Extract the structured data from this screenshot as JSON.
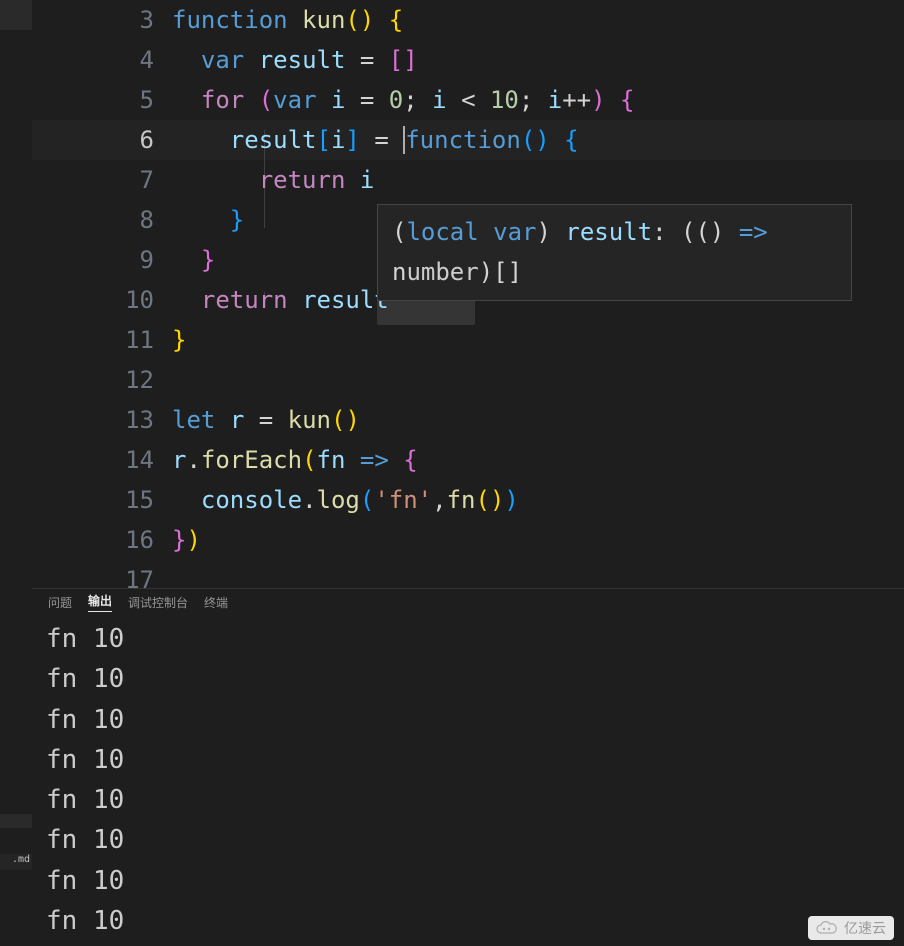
{
  "sidebar": {
    "file_ext_label": ".md"
  },
  "editor": {
    "lines": [
      {
        "num": "3",
        "tokens": [
          [
            "tk-keyword",
            "function"
          ],
          [
            "tk-punc",
            " "
          ],
          [
            "tk-fnname",
            "kun"
          ],
          [
            "tk-bracket-y",
            "("
          ],
          [
            "tk-bracket-y",
            ")"
          ],
          [
            "tk-punc",
            " "
          ],
          [
            "tk-bracket-y",
            "{"
          ]
        ]
      },
      {
        "num": "4",
        "indent": 1,
        "tokens": [
          [
            "tk-keyword",
            "var"
          ],
          [
            "tk-punc",
            " "
          ],
          [
            "tk-var",
            "result"
          ],
          [
            "tk-punc",
            " "
          ],
          [
            "tk-op",
            "="
          ],
          [
            "tk-punc",
            " "
          ],
          [
            "tk-bracket-p",
            "["
          ],
          [
            "tk-bracket-p",
            "]"
          ]
        ]
      },
      {
        "num": "5",
        "indent": 1,
        "tokens": [
          [
            "tk-keyword-ctrl",
            "for"
          ],
          [
            "tk-punc",
            " "
          ],
          [
            "tk-bracket-p",
            "("
          ],
          [
            "tk-keyword",
            "var"
          ],
          [
            "tk-punc",
            " "
          ],
          [
            "tk-var",
            "i"
          ],
          [
            "tk-punc",
            " "
          ],
          [
            "tk-op",
            "="
          ],
          [
            "tk-punc",
            " "
          ],
          [
            "tk-num",
            "0"
          ],
          [
            "tk-punc",
            ";"
          ],
          [
            "tk-punc",
            " "
          ],
          [
            "tk-var",
            "i"
          ],
          [
            "tk-punc",
            " "
          ],
          [
            "tk-op",
            "<"
          ],
          [
            "tk-punc",
            " "
          ],
          [
            "tk-num",
            "10"
          ],
          [
            "tk-punc",
            ";"
          ],
          [
            "tk-punc",
            " "
          ],
          [
            "tk-var",
            "i"
          ],
          [
            "tk-op",
            "++"
          ],
          [
            "tk-bracket-p",
            ")"
          ],
          [
            "tk-punc",
            " "
          ],
          [
            "tk-bracket-p",
            "{"
          ]
        ]
      },
      {
        "num": "6",
        "indent": 2,
        "active": true,
        "cursor_at": 3,
        "tokens": [
          [
            "tk-var",
            "result"
          ],
          [
            "tk-bracket-b",
            "["
          ],
          [
            "tk-var",
            "i"
          ],
          [
            "tk-bracket-b",
            "]"
          ],
          [
            "tk-punc",
            " "
          ],
          [
            "tk-op",
            "="
          ],
          [
            "tk-punc",
            " "
          ],
          [
            "tk-keyword",
            "function"
          ],
          [
            "tk-bracket-b",
            "("
          ],
          [
            "tk-bracket-b",
            ")"
          ],
          [
            "tk-punc",
            " "
          ],
          [
            "tk-bracket-b",
            "{"
          ]
        ]
      },
      {
        "num": "7",
        "indent": 3,
        "tokens": [
          [
            "tk-keyword-ctrl",
            "return"
          ],
          [
            "tk-punc",
            " "
          ],
          [
            "tk-var",
            "i"
          ]
        ]
      },
      {
        "num": "8",
        "indent": 2,
        "tokens": [
          [
            "tk-bracket-b",
            "}"
          ]
        ]
      },
      {
        "num": "9",
        "indent": 1,
        "tokens": [
          [
            "tk-bracket-p",
            "}"
          ]
        ]
      },
      {
        "num": "10",
        "indent": 1,
        "tokens": [
          [
            "tk-keyword-ctrl",
            "return"
          ],
          [
            "tk-punc",
            " "
          ],
          [
            "tk-var",
            "result"
          ]
        ]
      },
      {
        "num": "11",
        "tokens": [
          [
            "tk-bracket-y",
            "}"
          ]
        ]
      },
      {
        "num": "12",
        "tokens": []
      },
      {
        "num": "13",
        "tokens": [
          [
            "tk-keyword",
            "let"
          ],
          [
            "tk-punc",
            " "
          ],
          [
            "tk-var",
            "r"
          ],
          [
            "tk-punc",
            " "
          ],
          [
            "tk-op",
            "="
          ],
          [
            "tk-punc",
            " "
          ],
          [
            "tk-fnname",
            "kun"
          ],
          [
            "tk-bracket-y",
            "("
          ],
          [
            "tk-bracket-y",
            ")"
          ]
        ]
      },
      {
        "num": "14",
        "tokens": [
          [
            "tk-var",
            "r"
          ],
          [
            "tk-punc",
            "."
          ],
          [
            "tk-prop",
            "forEach"
          ],
          [
            "tk-bracket-y",
            "("
          ],
          [
            "tk-var",
            "fn"
          ],
          [
            "tk-punc",
            " "
          ],
          [
            "tk-keyword",
            "=>"
          ],
          [
            "tk-punc",
            " "
          ],
          [
            "tk-bracket-p",
            "{"
          ]
        ]
      },
      {
        "num": "15",
        "indent": 1,
        "tokens": [
          [
            "tk-var",
            "console"
          ],
          [
            "tk-punc",
            "."
          ],
          [
            "tk-prop",
            "log"
          ],
          [
            "tk-bracket-b",
            "("
          ],
          [
            "tk-str",
            "'fn'"
          ],
          [
            "tk-punc",
            ","
          ],
          [
            "tk-fnname",
            "fn"
          ],
          [
            "tk-bracket-y",
            "("
          ],
          [
            "tk-bracket-y",
            ")"
          ],
          [
            "tk-bracket-b",
            ")"
          ]
        ]
      },
      {
        "num": "16",
        "tokens": [
          [
            "tk-bracket-p",
            "}"
          ],
          [
            "tk-bracket-y",
            ")"
          ]
        ]
      },
      {
        "num": "17",
        "tokens": []
      }
    ],
    "indent_width": 2,
    "hover": {
      "text_parts": [
        [
          "tt-punc",
          "("
        ],
        [
          "tt-kw",
          "local var"
        ],
        [
          "tt-punc",
          ") "
        ],
        [
          "tt-var",
          "result"
        ],
        [
          "tt-punc",
          ": (() "
        ],
        [
          "tt-kw",
          "=>"
        ],
        [
          "tt-punc",
          " n"
        ],
        [
          "",
          "umber"
        ],
        [
          "tt-punc",
          ")[]"
        ]
      ]
    }
  },
  "panel": {
    "tabs": [
      {
        "label": "问题",
        "active": false
      },
      {
        "label": "输出",
        "active": true
      },
      {
        "label": "调试控制台",
        "active": false
      },
      {
        "label": "终端",
        "active": false
      }
    ],
    "output": [
      "fn 10",
      "fn 10",
      "fn 10",
      "fn 10",
      "fn 10",
      "fn 10",
      "fn 10",
      "fn 10"
    ]
  },
  "watermark": {
    "text": "亿速云"
  }
}
